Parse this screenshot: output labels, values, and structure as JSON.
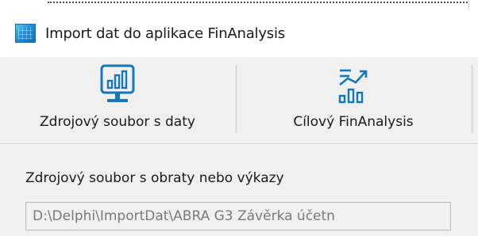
{
  "window": {
    "title": "Import dat do aplikace FinAnalysis",
    "app_icon": "app-window-icon"
  },
  "toolbar": {
    "source_button": {
      "label": "Zdrojový soubor s daty",
      "icon": "monitor-chart-icon"
    },
    "target_button": {
      "label": "Cílový FinAnalysis",
      "icon": "trend-bars-icon"
    }
  },
  "source": {
    "label": "Zdrojový soubor s obraty nebo výkazy",
    "path_value": "D:\\Delphi\\ImportDat\\ABRA G3 Závěrka účetn"
  },
  "colors": {
    "icon_accent": "#1377b8",
    "toolbar_bg": "#f0f0f0",
    "title_bg": "#ffffff"
  }
}
